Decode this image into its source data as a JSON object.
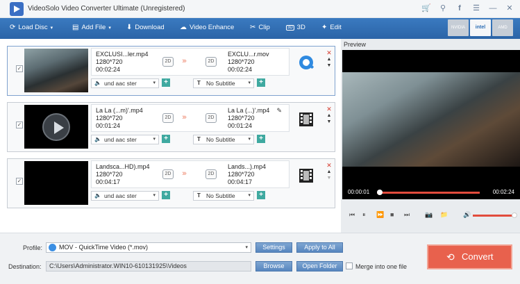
{
  "window": {
    "title": "VideoSolo Video Converter Ultimate (Unregistered)",
    "icons": [
      "cart-icon",
      "thermometer-icon",
      "facebook-icon",
      "menu-icon",
      "minimize-icon",
      "close-icon"
    ]
  },
  "toolbar": {
    "load_disc": "Load Disc",
    "add_file": "Add File",
    "download": "Download",
    "video_enhance": "Video Enhance",
    "clip": "Clip",
    "three_d": "3D",
    "edit": "Edit",
    "hw": [
      "NVIDIA",
      "intel",
      "AMD"
    ]
  },
  "files": [
    {
      "src_name": "EXCLUSI...ler.mp4",
      "src_res": "1280*720",
      "src_dur": "00:02:24",
      "dst_name": "EXCLU...r.mov",
      "dst_res": "1280*720",
      "dst_dur": "00:02:24",
      "badge": "2D",
      "audio": "und aac ster",
      "subtitle": "No Subtitle",
      "checked": "✓"
    },
    {
      "src_name": "La La (...m)'.mp4",
      "src_res": "1280*720",
      "src_dur": "00:01:24",
      "dst_name": "La La (...)'.mp4",
      "dst_res": "1280*720",
      "dst_dur": "00:01:24",
      "badge": "2D",
      "audio": "und aac ster",
      "subtitle": "No Subtitle",
      "checked": "✓"
    },
    {
      "src_name": "Landsca...HD).mp4",
      "src_res": "1280*720",
      "src_dur": "00:04:17",
      "dst_name": "Lands...).mp4",
      "dst_res": "1280*720",
      "dst_dur": "00:04:17",
      "badge": "2D",
      "audio": "und aac ster",
      "subtitle": "No Subtitle",
      "checked": "✓"
    }
  ],
  "preview": {
    "label": "Preview",
    "time_current": "00:00:01",
    "time_total": "00:02:24",
    "progress": 0.01,
    "volume": 0.95
  },
  "bottom": {
    "profile_label": "Profile:",
    "profile_value": "MOV - QuickTime Video (*.mov)",
    "settings": "Settings",
    "apply_to_all": "Apply to All",
    "destination_label": "Destination:",
    "destination_value": "C:\\Users\\Administrator.WIN10-610131925\\Videos",
    "browse": "Browse",
    "open_folder": "Open Folder",
    "merge_label": "Merge into one file",
    "convert": "Convert"
  },
  "colors": {
    "toolbar": "#2f6fb5",
    "accent_red": "#e8614d",
    "add_teal": "#3fa9a0"
  }
}
